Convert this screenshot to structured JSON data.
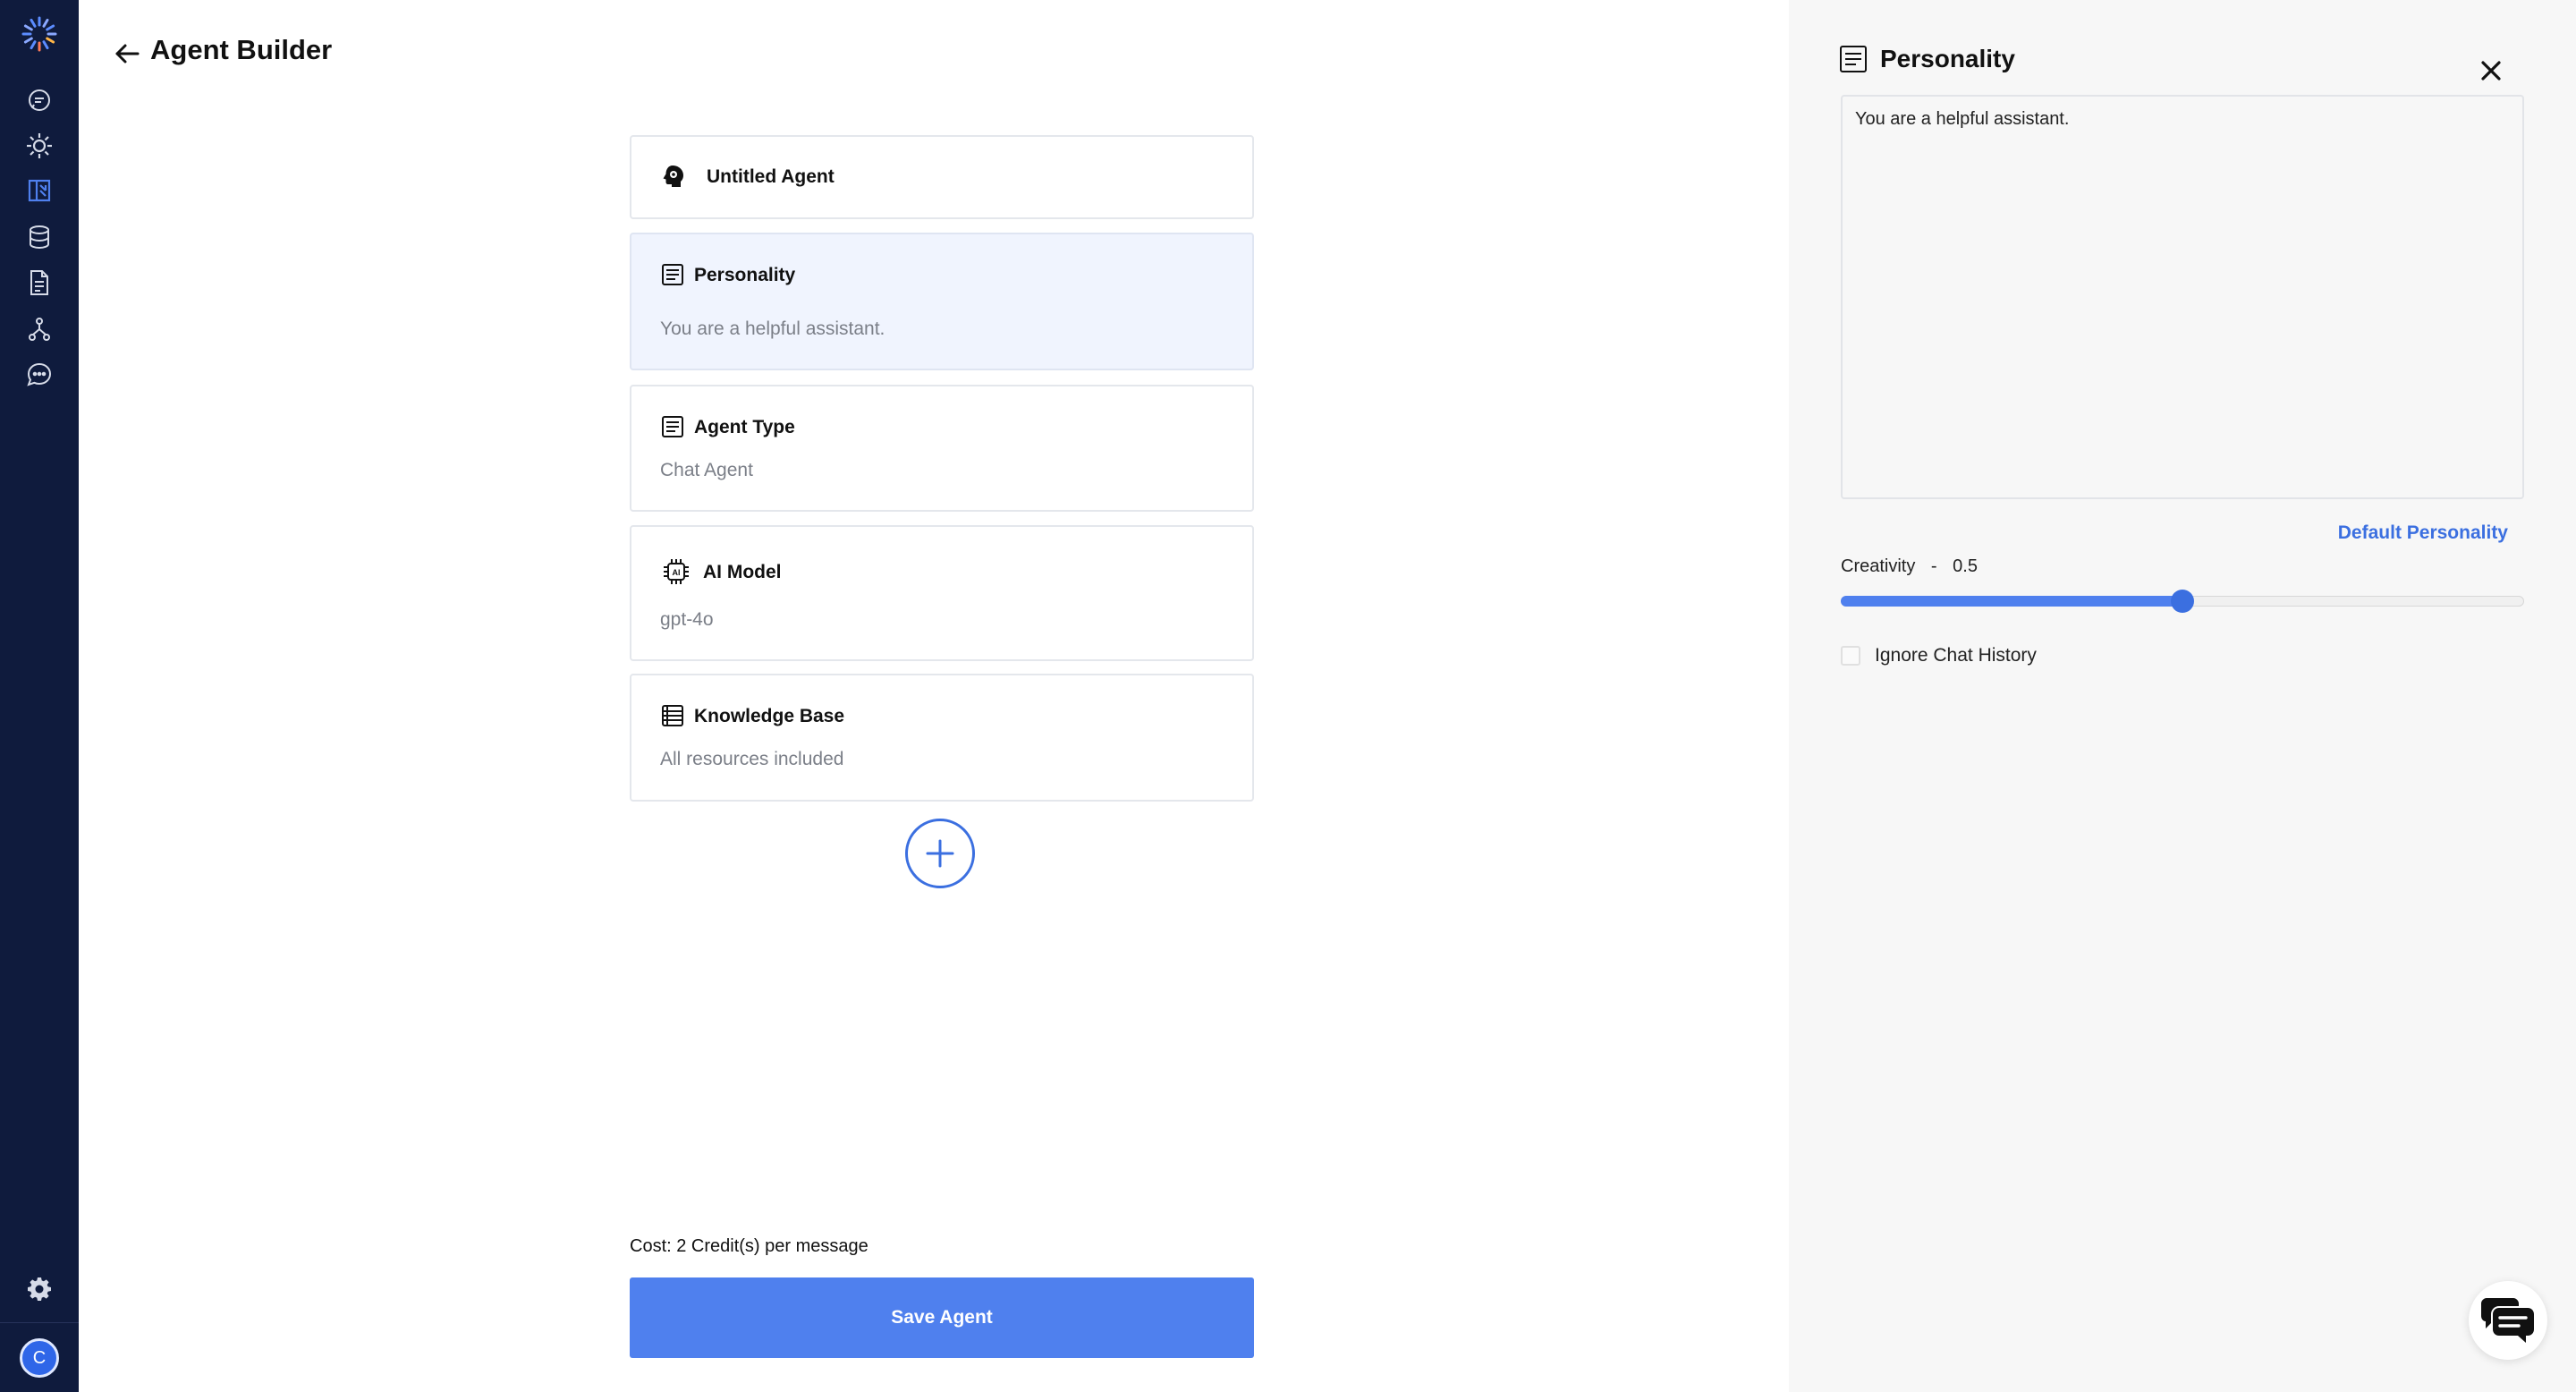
{
  "header": {
    "title": "Agent Builder"
  },
  "nav": {
    "items": [
      "chat-icon",
      "sun-icon",
      "builder-icon",
      "database-icon",
      "document-icon",
      "workflow-icon",
      "messages-icon"
    ],
    "settings_icon": "gear-icon",
    "avatar_letter": "C"
  },
  "cards": {
    "agent_name": "Untitled Agent",
    "personality": {
      "title": "Personality",
      "value": "You are a helpful assistant."
    },
    "agent_type": {
      "title": "Agent Type",
      "value": "Chat Agent"
    },
    "ai_model": {
      "title": "AI Model",
      "value": "gpt-4o"
    },
    "knowledge_base": {
      "title": "Knowledge Base",
      "value": "All resources included"
    }
  },
  "footer": {
    "cost": "Cost: 2 Credit(s) per message",
    "save_label": "Save Agent"
  },
  "panel": {
    "title": "Personality",
    "textarea_value": "You are a helpful assistant.",
    "default_link": "Default Personality",
    "creativity_label": "Creativity",
    "creativity_sep": "-",
    "creativity_value": "0.5",
    "creativity_fraction": 0.5,
    "ignore_history_label": "Ignore Chat History",
    "ignore_history_checked": false
  },
  "colors": {
    "rail": "#0f1b3d",
    "accent": "#4f80ee",
    "active_card": "#f0f4fe",
    "panel_bg": "#f7f7f7"
  }
}
